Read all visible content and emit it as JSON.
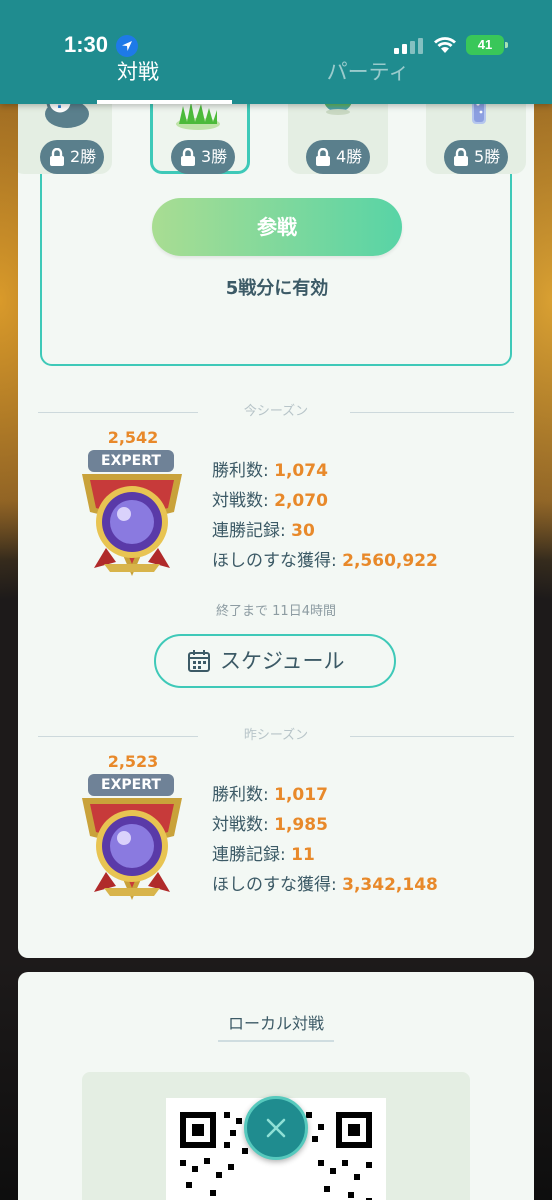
{
  "status_bar": {
    "time": "1:30",
    "battery": "41"
  },
  "tabs": [
    {
      "label": "対戦"
    },
    {
      "label": "パーティ"
    }
  ],
  "rewards": [
    {
      "label": "2勝"
    },
    {
      "label": "3勝"
    },
    {
      "label": "4勝"
    },
    {
      "label": "5勝"
    }
  ],
  "join_button": "参戦",
  "valid_text": "5戦分に有効",
  "current_season": {
    "divider": "今シーズン",
    "rating": "2,542",
    "rank": "EXPERT",
    "stats": [
      {
        "label": "勝利数: ",
        "value": "1,074"
      },
      {
        "label": "対戦数: ",
        "value": "2,070"
      },
      {
        "label": "連勝記録: ",
        "value": "30"
      },
      {
        "label": "ほしのすな獲得: ",
        "value": "2,560,922"
      }
    ],
    "ends_in": "終了まで 11日4時間",
    "schedule_button": "スケジュール"
  },
  "previous_season": {
    "divider": "昨シーズン",
    "rating": "2,523",
    "rank": "EXPERT",
    "stats": [
      {
        "label": "勝利数: ",
        "value": "1,017"
      },
      {
        "label": "対戦数: ",
        "value": "1,985"
      },
      {
        "label": "連勝記録: ",
        "value": "11"
      },
      {
        "label": "ほしのすな獲得: ",
        "value": "3,342,148"
      }
    ]
  },
  "local": {
    "title": "ローカル対戦"
  },
  "colors": {
    "header": "#1f8c8f",
    "accent_teal": "#3ec9b8",
    "stat_value": "#e8892a",
    "expert_badge": "#6f8297"
  }
}
